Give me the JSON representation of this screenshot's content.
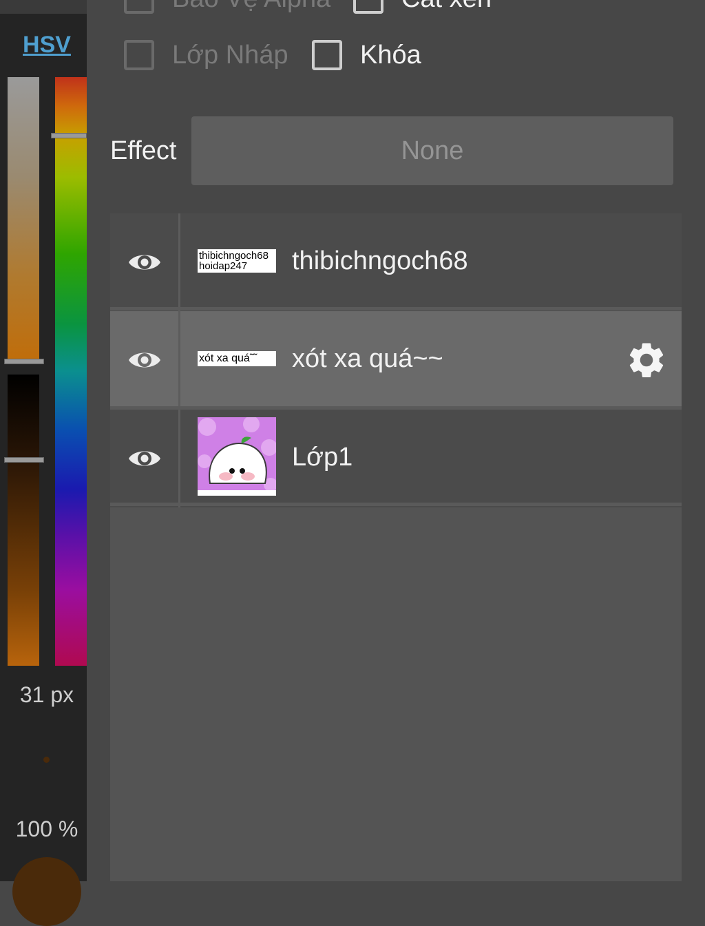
{
  "sidebar": {
    "mode_label": "HSV",
    "brush_size": "31 px",
    "opacity": "100 %",
    "colors": {
      "current": "#4a2a0a"
    }
  },
  "layer_options": {
    "checkboxes": [
      {
        "label": "Bảo Vệ Alpha",
        "checked": false,
        "enabled": false
      },
      {
        "label": "Cắt xén",
        "checked": false,
        "enabled": true
      },
      {
        "label": "Lớp Nháp",
        "checked": false,
        "enabled": false
      },
      {
        "label": "Khóa",
        "checked": false,
        "enabled": true
      }
    ],
    "effect": {
      "label": "Effect",
      "value": "None"
    }
  },
  "layers": [
    {
      "name": "thibichngoch68",
      "thumb_lines": [
        "thibichngoch68",
        "hoidap247"
      ],
      "visible": true,
      "selected": false,
      "icon": "eye-icon"
    },
    {
      "name": "xót xa quá~~",
      "thumb_lines": [
        "xót xa quá˜˜"
      ],
      "visible": true,
      "selected": true,
      "icon": "eye-icon",
      "settings_icon": "gear-icon"
    },
    {
      "name": "Lớp1",
      "thumb": "cartoon-character-image",
      "visible": true,
      "selected": false,
      "icon": "eye-icon"
    }
  ]
}
